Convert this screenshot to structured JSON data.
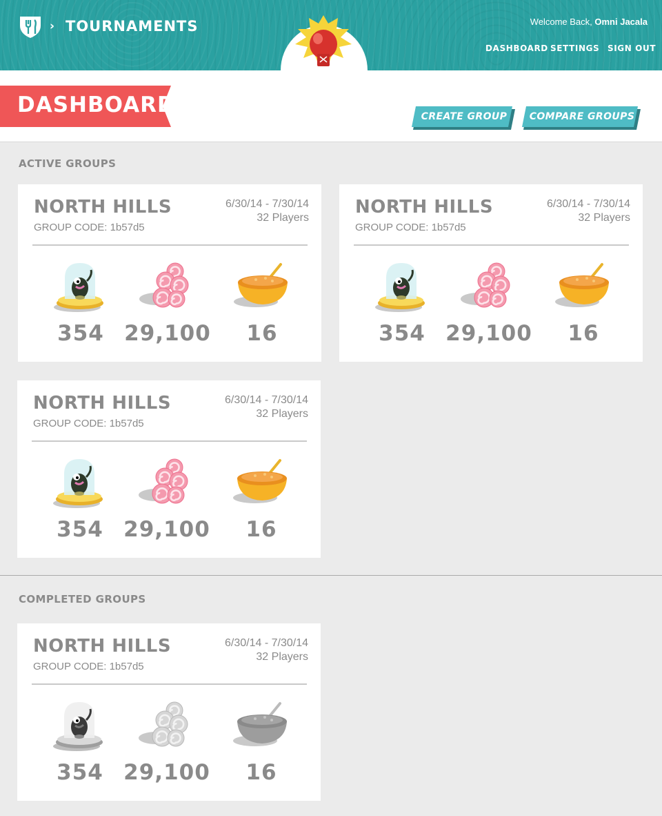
{
  "header": {
    "app_title": "TOURNAMENTS",
    "breadcrumb_separator": "›",
    "welcome_prefix": "Welcome Back, ",
    "user_name": "Omni Jacala",
    "nav": [
      "DASHBOARD",
      "SETTINGS",
      "SIGN OUT"
    ]
  },
  "page": {
    "title": "DASHBOARD",
    "create_group_label": "CREATE GROUP",
    "compare_groups_label": "COMPARE GROUPS"
  },
  "active_groups": {
    "heading": "ACTIVE GROUPS",
    "groups": [
      {
        "name": "NORTH HILLS",
        "code": "GROUP CODE: 1b57d5",
        "dates": "6/30/14 - 7/30/14",
        "players": "32 Players",
        "stats": [
          "354",
          "29,100",
          "16"
        ]
      },
      {
        "name": "NORTH HILLS",
        "code": "GROUP CODE: 1b57d5",
        "dates": "6/30/14 - 7/30/14",
        "players": "32 Players",
        "stats": [
          "354",
          "29,100",
          "16"
        ]
      },
      {
        "name": "NORTH HILLS",
        "code": "GROUP CODE: 1b57d5",
        "dates": "6/30/14 - 7/30/14",
        "players": "32 Players",
        "stats": [
          "354",
          "29,100",
          "16"
        ]
      }
    ]
  },
  "completed_groups": {
    "heading": "COMPLETED GROUPS",
    "groups": [
      {
        "name": "NORTH HILLS",
        "code": "GROUP CODE: 1b57d5",
        "dates": "6/30/14 - 7/30/14",
        "players": "32 Players",
        "stats": [
          "354",
          "29,100",
          "16"
        ]
      }
    ]
  },
  "icons": {
    "logo": "shield-utensils-icon",
    "mascot": "boxing-glove-icon",
    "stats": [
      "monster-trophy-icon",
      "candy-swirl-icon",
      "bowl-icon"
    ]
  },
  "colors": {
    "header_teal": "#2aa1a1",
    "ribbon_red": "#ef5657",
    "button_teal": "#4fbcc5",
    "text_gray": "#8a8a8a"
  }
}
